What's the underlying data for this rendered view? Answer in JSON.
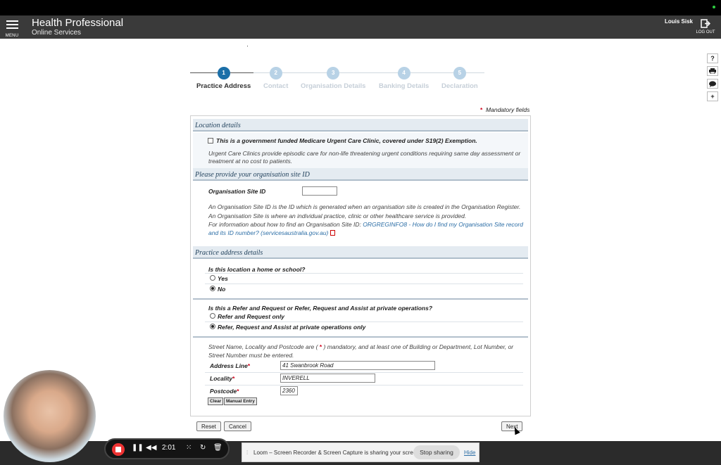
{
  "header": {
    "menu_label": "MENU",
    "brand_line1": "Health Professional",
    "brand_line2": "Online Services",
    "user_name": "Louis Sisk",
    "logout_label": "LOG OUT"
  },
  "side_icons": [
    "help-icon",
    "print-icon",
    "chat-icon",
    "plus-icon"
  ],
  "stepper": {
    "steps": [
      {
        "num": "1",
        "label": "Practice Address"
      },
      {
        "num": "2",
        "label": "Contact"
      },
      {
        "num": "3",
        "label": "Organisation Details"
      },
      {
        "num": "4",
        "label": "Banking Details"
      },
      {
        "num": "5",
        "label": "Declaration"
      }
    ],
    "active_step": 1
  },
  "mandatory": {
    "star": "*",
    "text": "Mandatory fields"
  },
  "location": {
    "heading": "Location details",
    "checkbox_label": "This is a government funded Medicare Urgent Care Clinic, covered under S19(2) Exemption.",
    "checked": false,
    "note": "Urgent Care Clinics provide episodic care for non-life threatening urgent conditions requiring same day assessment or treatment at no cost to patients."
  },
  "site_id": {
    "heading": "Please provide your organisation site ID",
    "label": "Organisation Site ID",
    "value": "",
    "info1": "An Organisation Site ID is the ID which is generated when an organisation site is created in the Organisation Register.",
    "info2": "An Organisation Site is where an individual practice, clinic or other healthcare service is provided.",
    "info3": "For information about how to find an Organisation Site ID:",
    "link_line1": "ORGREGINFO8 - How do I find my Organisation Site record",
    "link_line2": "and its ID number? (servicesaustralia.gov.au)"
  },
  "practice": {
    "heading": "Practice address details",
    "q1": "Is this location a home or school?",
    "q1_options": [
      "Yes",
      "No"
    ],
    "q1_selected": "No",
    "q2": "Is this a Refer and Request or Refer, Request and Assist at private operations?",
    "q2_options": [
      "Refer and Request only",
      "Refer, Request and Assist at private operations only"
    ],
    "q2_selected": "Refer, Request and Assist at private operations only",
    "rule_pre": "Street Name, Locality and Postcode are (",
    "rule_star": "*",
    "rule_post": ") mandatory, and at least one of Building or Department, Lot Number, or",
    "rule_line2": "Street Number must be entered.",
    "address_label": "Address Line",
    "address_value": "41 Swanbrook Road",
    "locality_label": "Locality",
    "locality_value": "INVERELL",
    "postcode_label": "Postcode",
    "postcode_value": "2360",
    "req_star": "*",
    "clear_label": "Clear",
    "manual_label": "Manual Entry"
  },
  "actions": {
    "reset": "Reset",
    "cancel": "Cancel",
    "next": "Next"
  },
  "loom": {
    "time": "2:01",
    "share_msg": "Loom – Screen Recorder & Screen Capture is sharing your screen.",
    "stop_label": "Stop sharing",
    "hide_label": "Hide"
  }
}
